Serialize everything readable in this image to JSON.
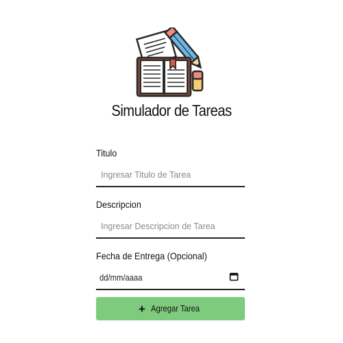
{
  "app": {
    "title": "Simulador de Tareas",
    "logo_icon": "notebook-pencil-icon"
  },
  "form": {
    "title_field": {
      "label": "Titulo",
      "placeholder": "Ingresar Titulo de Tarea",
      "value": ""
    },
    "description_field": {
      "label": "Descripcion",
      "placeholder": "Ingresar Descripcion de Tarea",
      "value": ""
    },
    "date_field": {
      "label": "Fecha de Entrega (Opcional)",
      "value": "dd/mm/aaaa",
      "icon": "calendar-icon"
    },
    "submit": {
      "icon": "plus-icon",
      "icon_glyph": "+",
      "label": "Agregar Tarea"
    }
  },
  "colors": {
    "button_background": "#7fcb7e",
    "underline": "#222222"
  }
}
